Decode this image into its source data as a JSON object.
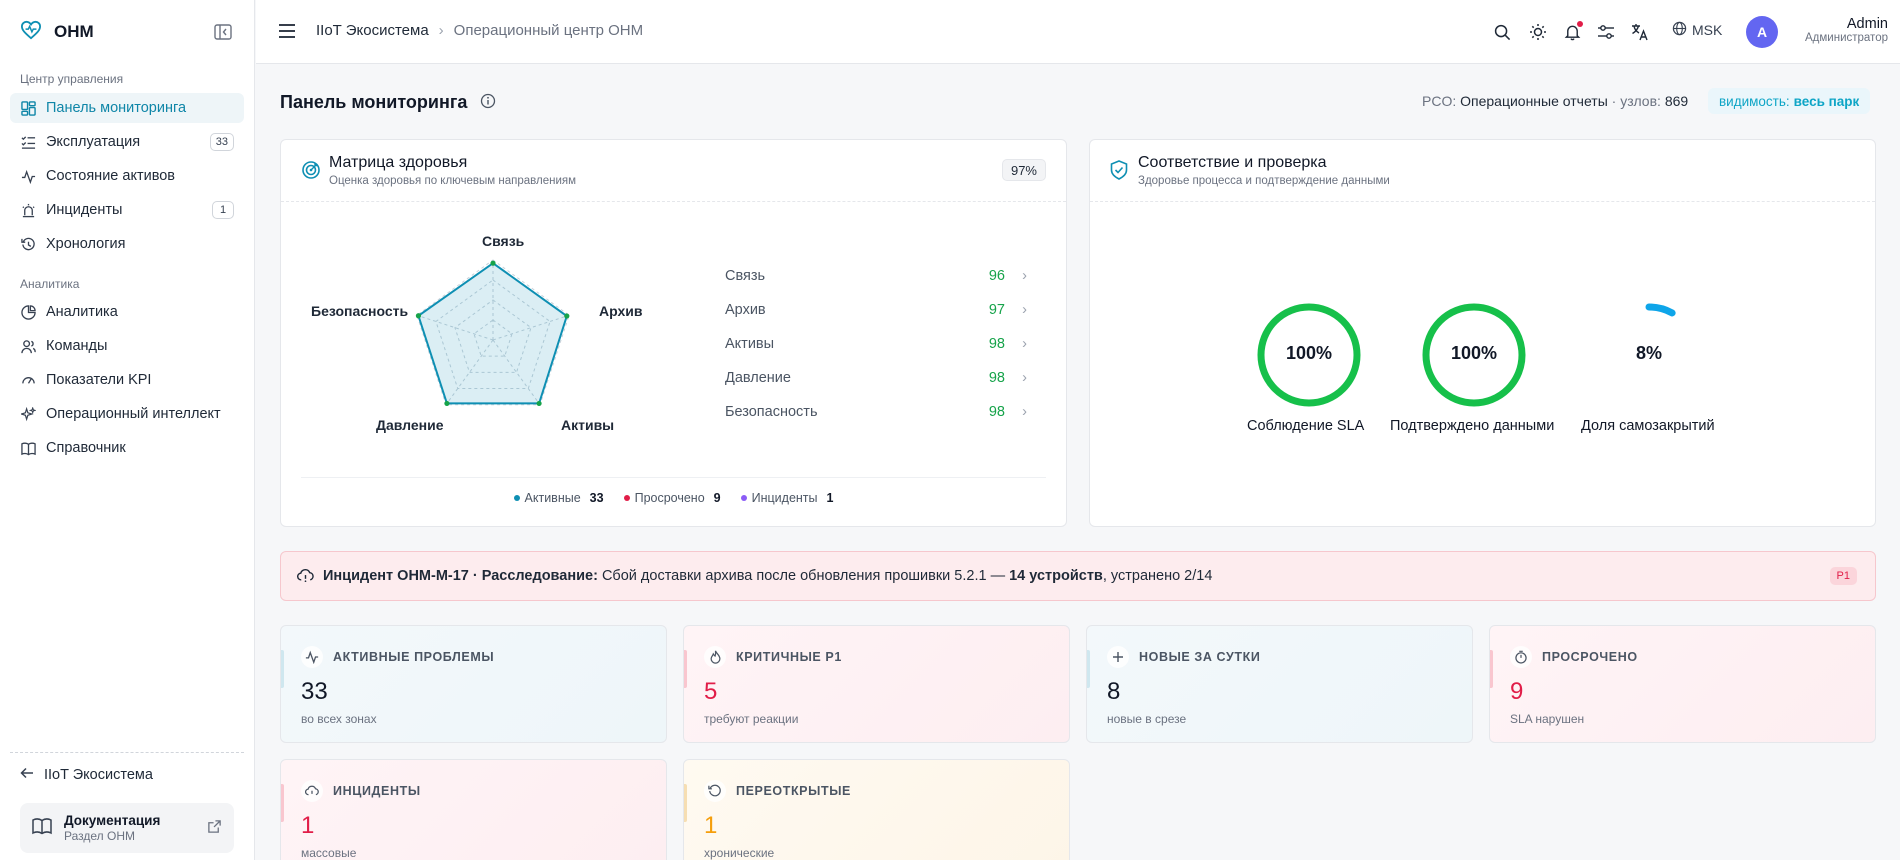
{
  "app": {
    "name": "ОНМ"
  },
  "sidebar": {
    "section1": "Центр управления",
    "section2": "Аналитика",
    "items": [
      {
        "label": "Панель мониторинга",
        "icon": "dashboard-icon"
      },
      {
        "label": "Эксплуатация",
        "badge": "33",
        "icon": "tasks-icon"
      },
      {
        "label": "Состояние активов",
        "icon": "activity-icon"
      },
      {
        "label": "Инциденты",
        "badge": "1",
        "icon": "siren-icon"
      },
      {
        "label": "Хронология",
        "icon": "history-icon"
      },
      {
        "label": "Аналитика",
        "icon": "chart-icon"
      },
      {
        "label": "Команды",
        "icon": "users-icon"
      },
      {
        "label": "Показатели KPI",
        "icon": "kpi-icon"
      },
      {
        "label": "Операционный интеллект",
        "icon": "sparkle-icon"
      },
      {
        "label": "Справочник",
        "icon": "book-icon"
      }
    ],
    "back": "IIoT Экосистема",
    "doc_title": "Документация",
    "doc_sub": "Раздел ОНМ"
  },
  "topbar": {
    "crumb1": "IIoT Экосистема",
    "crumb2": "Операционный центр ОНМ",
    "timezone": "MSK",
    "avatar": "A",
    "user_name": "Admin",
    "user_role": "Администратор"
  },
  "page": {
    "title": "Панель мониторинга",
    "pco_prefix": "PCO:",
    "pco_value": "Операционные отчеты",
    "pco_nodes": "· узлов:",
    "pco_nodes_value": "869",
    "visibility_label": "видимость:",
    "visibility_value": "весь парк"
  },
  "health": {
    "title": "Матрица здоровья",
    "subtitle": "Оценка здоровья по ключевым направлениям",
    "overall": "97%",
    "axes": [
      {
        "label": "Связь",
        "value": 96
      },
      {
        "label": "Архив",
        "value": 97
      },
      {
        "label": "Активы",
        "value": 98
      },
      {
        "label": "Давление",
        "value": 98
      },
      {
        "label": "Безопасность",
        "value": 98
      }
    ],
    "legend": [
      {
        "label": "Активные",
        "value": "33",
        "color": "#0e8fb3"
      },
      {
        "label": "Просрочено",
        "value": "9",
        "color": "#e11d48"
      },
      {
        "label": "Инциденты",
        "value": "1",
        "color": "#8b5cf6"
      }
    ]
  },
  "compliance": {
    "title": "Соответствие и проверка",
    "subtitle": "Здоровье процесса и подтверждение данными",
    "gauges": [
      {
        "value": "100%",
        "fraction": 1.0,
        "label": "Соблюдение SLA",
        "color": "#16c04a"
      },
      {
        "value": "100%",
        "fraction": 1.0,
        "label": "Подтверждено данными",
        "color": "#16c04a"
      },
      {
        "value": "8%",
        "fraction": 0.08,
        "label": "Доля самозакрытий",
        "color": "#0ea5e9"
      }
    ]
  },
  "incident": {
    "id_label": "Инцидент ОНМ-М-17 · Расследование:",
    "text": "Сбой доставки архива после обновления прошивки 5.2.1 —",
    "devices": "14 устройств",
    "fixed": ", устранено 2/14",
    "priority": "P1"
  },
  "kpis": [
    {
      "title": "АКТИВНЫЕ ПРОБЛЕМЫ",
      "value": "33",
      "sub": "во всех зонах",
      "icon": "activity-icon",
      "value_color": "#111827"
    },
    {
      "title": "КРИТИЧНЫЕ P1",
      "value": "5",
      "sub": "требуют реакции",
      "icon": "flame-icon",
      "value_color": "#e11d48"
    },
    {
      "title": "НОВЫЕ ЗА СУТКИ",
      "value": "8",
      "sub": "новые в срезе",
      "icon": "plus-icon",
      "value_color": "#111827"
    },
    {
      "title": "ПРОСРОЧЕНО",
      "value": "9",
      "sub": "SLA нарушен",
      "icon": "timer-icon",
      "value_color": "#e11d48"
    },
    {
      "title": "ИНЦИДЕНТЫ",
      "value": "1",
      "sub": "массовые",
      "icon": "cloud-alert-icon",
      "value_color": "#e11d48"
    },
    {
      "title": "ПЕРЕОТКРЫТЫЕ",
      "value": "1",
      "sub": "хронические",
      "icon": "reopen-icon",
      "value_color": "#f59e0b"
    }
  ]
}
